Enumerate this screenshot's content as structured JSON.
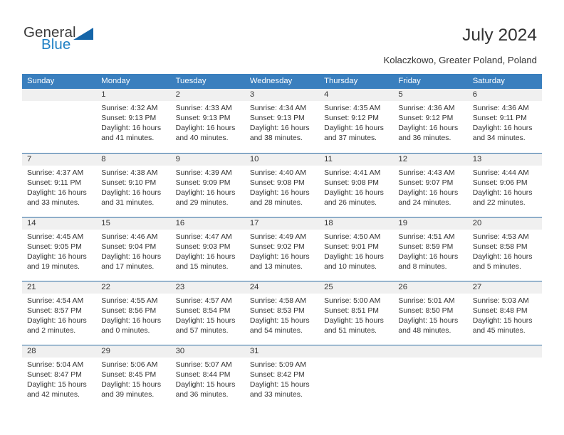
{
  "brand": {
    "name_part1": "General",
    "name_part2": "Blue",
    "triangle_icon": "triangle-icon",
    "accent_color": "#1e7fc4",
    "triangle_color": "#1565a8"
  },
  "header": {
    "title": "July 2024",
    "subtitle": "Kolaczkowo, Greater Poland, Poland"
  },
  "calendar": {
    "header_bg": "#3a7fbe",
    "row_border_color": "#2e6da4",
    "daynum_band_bg": "#f0f0f0",
    "weekday_headers": [
      "Sunday",
      "Monday",
      "Tuesday",
      "Wednesday",
      "Thursday",
      "Friday",
      "Saturday"
    ],
    "weeks": [
      [
        {
          "day": "",
          "sunrise": "",
          "sunset": "",
          "daylight_line1": "",
          "daylight_line2": "",
          "empty": true
        },
        {
          "day": "1",
          "sunrise": "Sunrise: 4:32 AM",
          "sunset": "Sunset: 9:13 PM",
          "daylight_line1": "Daylight: 16 hours",
          "daylight_line2": "and 41 minutes."
        },
        {
          "day": "2",
          "sunrise": "Sunrise: 4:33 AM",
          "sunset": "Sunset: 9:13 PM",
          "daylight_line1": "Daylight: 16 hours",
          "daylight_line2": "and 40 minutes."
        },
        {
          "day": "3",
          "sunrise": "Sunrise: 4:34 AM",
          "sunset": "Sunset: 9:13 PM",
          "daylight_line1": "Daylight: 16 hours",
          "daylight_line2": "and 38 minutes."
        },
        {
          "day": "4",
          "sunrise": "Sunrise: 4:35 AM",
          "sunset": "Sunset: 9:12 PM",
          "daylight_line1": "Daylight: 16 hours",
          "daylight_line2": "and 37 minutes."
        },
        {
          "day": "5",
          "sunrise": "Sunrise: 4:36 AM",
          "sunset": "Sunset: 9:12 PM",
          "daylight_line1": "Daylight: 16 hours",
          "daylight_line2": "and 36 minutes."
        },
        {
          "day": "6",
          "sunrise": "Sunrise: 4:36 AM",
          "sunset": "Sunset: 9:11 PM",
          "daylight_line1": "Daylight: 16 hours",
          "daylight_line2": "and 34 minutes."
        }
      ],
      [
        {
          "day": "7",
          "sunrise": "Sunrise: 4:37 AM",
          "sunset": "Sunset: 9:11 PM",
          "daylight_line1": "Daylight: 16 hours",
          "daylight_line2": "and 33 minutes."
        },
        {
          "day": "8",
          "sunrise": "Sunrise: 4:38 AM",
          "sunset": "Sunset: 9:10 PM",
          "daylight_line1": "Daylight: 16 hours",
          "daylight_line2": "and 31 minutes."
        },
        {
          "day": "9",
          "sunrise": "Sunrise: 4:39 AM",
          "sunset": "Sunset: 9:09 PM",
          "daylight_line1": "Daylight: 16 hours",
          "daylight_line2": "and 29 minutes."
        },
        {
          "day": "10",
          "sunrise": "Sunrise: 4:40 AM",
          "sunset": "Sunset: 9:08 PM",
          "daylight_line1": "Daylight: 16 hours",
          "daylight_line2": "and 28 minutes."
        },
        {
          "day": "11",
          "sunrise": "Sunrise: 4:41 AM",
          "sunset": "Sunset: 9:08 PM",
          "daylight_line1": "Daylight: 16 hours",
          "daylight_line2": "and 26 minutes."
        },
        {
          "day": "12",
          "sunrise": "Sunrise: 4:43 AM",
          "sunset": "Sunset: 9:07 PM",
          "daylight_line1": "Daylight: 16 hours",
          "daylight_line2": "and 24 minutes."
        },
        {
          "day": "13",
          "sunrise": "Sunrise: 4:44 AM",
          "sunset": "Sunset: 9:06 PM",
          "daylight_line1": "Daylight: 16 hours",
          "daylight_line2": "and 22 minutes."
        }
      ],
      [
        {
          "day": "14",
          "sunrise": "Sunrise: 4:45 AM",
          "sunset": "Sunset: 9:05 PM",
          "daylight_line1": "Daylight: 16 hours",
          "daylight_line2": "and 19 minutes."
        },
        {
          "day": "15",
          "sunrise": "Sunrise: 4:46 AM",
          "sunset": "Sunset: 9:04 PM",
          "daylight_line1": "Daylight: 16 hours",
          "daylight_line2": "and 17 minutes."
        },
        {
          "day": "16",
          "sunrise": "Sunrise: 4:47 AM",
          "sunset": "Sunset: 9:03 PM",
          "daylight_line1": "Daylight: 16 hours",
          "daylight_line2": "and 15 minutes."
        },
        {
          "day": "17",
          "sunrise": "Sunrise: 4:49 AM",
          "sunset": "Sunset: 9:02 PM",
          "daylight_line1": "Daylight: 16 hours",
          "daylight_line2": "and 13 minutes."
        },
        {
          "day": "18",
          "sunrise": "Sunrise: 4:50 AM",
          "sunset": "Sunset: 9:01 PM",
          "daylight_line1": "Daylight: 16 hours",
          "daylight_line2": "and 10 minutes."
        },
        {
          "day": "19",
          "sunrise": "Sunrise: 4:51 AM",
          "sunset": "Sunset: 8:59 PM",
          "daylight_line1": "Daylight: 16 hours",
          "daylight_line2": "and 8 minutes."
        },
        {
          "day": "20",
          "sunrise": "Sunrise: 4:53 AM",
          "sunset": "Sunset: 8:58 PM",
          "daylight_line1": "Daylight: 16 hours",
          "daylight_line2": "and 5 minutes."
        }
      ],
      [
        {
          "day": "21",
          "sunrise": "Sunrise: 4:54 AM",
          "sunset": "Sunset: 8:57 PM",
          "daylight_line1": "Daylight: 16 hours",
          "daylight_line2": "and 2 minutes."
        },
        {
          "day": "22",
          "sunrise": "Sunrise: 4:55 AM",
          "sunset": "Sunset: 8:56 PM",
          "daylight_line1": "Daylight: 16 hours",
          "daylight_line2": "and 0 minutes."
        },
        {
          "day": "23",
          "sunrise": "Sunrise: 4:57 AM",
          "sunset": "Sunset: 8:54 PM",
          "daylight_line1": "Daylight: 15 hours",
          "daylight_line2": "and 57 minutes."
        },
        {
          "day": "24",
          "sunrise": "Sunrise: 4:58 AM",
          "sunset": "Sunset: 8:53 PM",
          "daylight_line1": "Daylight: 15 hours",
          "daylight_line2": "and 54 minutes."
        },
        {
          "day": "25",
          "sunrise": "Sunrise: 5:00 AM",
          "sunset": "Sunset: 8:51 PM",
          "daylight_line1": "Daylight: 15 hours",
          "daylight_line2": "and 51 minutes."
        },
        {
          "day": "26",
          "sunrise": "Sunrise: 5:01 AM",
          "sunset": "Sunset: 8:50 PM",
          "daylight_line1": "Daylight: 15 hours",
          "daylight_line2": "and 48 minutes."
        },
        {
          "day": "27",
          "sunrise": "Sunrise: 5:03 AM",
          "sunset": "Sunset: 8:48 PM",
          "daylight_line1": "Daylight: 15 hours",
          "daylight_line2": "and 45 minutes."
        }
      ],
      [
        {
          "day": "28",
          "sunrise": "Sunrise: 5:04 AM",
          "sunset": "Sunset: 8:47 PM",
          "daylight_line1": "Daylight: 15 hours",
          "daylight_line2": "and 42 minutes."
        },
        {
          "day": "29",
          "sunrise": "Sunrise: 5:06 AM",
          "sunset": "Sunset: 8:45 PM",
          "daylight_line1": "Daylight: 15 hours",
          "daylight_line2": "and 39 minutes."
        },
        {
          "day": "30",
          "sunrise": "Sunrise: 5:07 AM",
          "sunset": "Sunset: 8:44 PM",
          "daylight_line1": "Daylight: 15 hours",
          "daylight_line2": "and 36 minutes."
        },
        {
          "day": "31",
          "sunrise": "Sunrise: 5:09 AM",
          "sunset": "Sunset: 8:42 PM",
          "daylight_line1": "Daylight: 15 hours",
          "daylight_line2": "and 33 minutes."
        },
        {
          "day": "",
          "sunrise": "",
          "sunset": "",
          "daylight_line1": "",
          "daylight_line2": "",
          "empty": true
        },
        {
          "day": "",
          "sunrise": "",
          "sunset": "",
          "daylight_line1": "",
          "daylight_line2": "",
          "empty": true
        },
        {
          "day": "",
          "sunrise": "",
          "sunset": "",
          "daylight_line1": "",
          "daylight_line2": "",
          "empty": true
        }
      ]
    ]
  }
}
